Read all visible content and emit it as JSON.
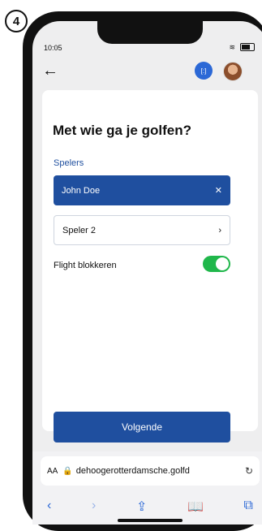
{
  "step": "4",
  "status": {
    "time": "10:05"
  },
  "page": {
    "title": "Met wie ga je golfen?",
    "players_label": "Spelers",
    "players": [
      {
        "name": "John Doe"
      },
      {
        "name": "Speler 2"
      }
    ],
    "flight_label": "Flight blokkeren",
    "next_button": "Volgende"
  },
  "browser": {
    "aa": "AA",
    "url": "dehoogerotterdamsche.golfd"
  },
  "colors": {
    "primary": "#1f4f9f",
    "toggle_on": "#20b74b",
    "accent": "#2b68d6"
  },
  "icons": [
    "back-arrow-icon",
    "scan-icon",
    "avatar",
    "close-icon",
    "chevron-right-icon",
    "lock-icon",
    "reload-icon",
    "back-icon",
    "forward-icon",
    "share-icon",
    "bookmark-icon",
    "tabs-icon"
  ]
}
